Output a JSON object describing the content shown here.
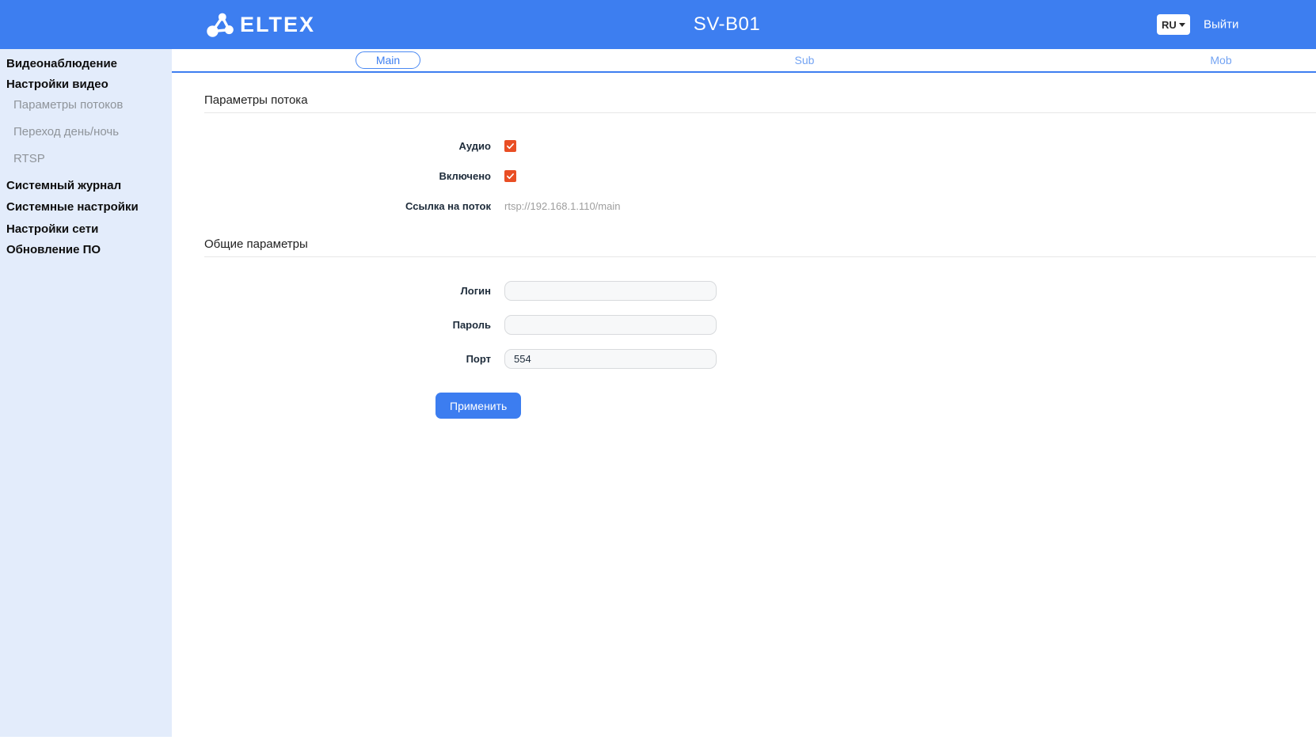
{
  "header": {
    "brand": "ELTEX",
    "title": "SV-B01",
    "language": "RU",
    "logout_label": "Выйти"
  },
  "sidebar": {
    "items": [
      {
        "label": "Видеонаблюдение",
        "type": "section"
      },
      {
        "label": "Настройки видео",
        "type": "section"
      },
      {
        "label": "Параметры потоков",
        "type": "sub"
      },
      {
        "label": "Переход день/ночь",
        "type": "sub"
      },
      {
        "label": "RTSP",
        "type": "sub"
      },
      {
        "label": "Системный журнал",
        "type": "section"
      },
      {
        "label": "Системные настройки",
        "type": "section"
      },
      {
        "label": "Настройки сети",
        "type": "section"
      },
      {
        "label": "Обновление ПО",
        "type": "section"
      }
    ]
  },
  "tabs": [
    {
      "label": "Main",
      "active": true
    },
    {
      "label": "Sub",
      "active": false
    },
    {
      "label": "Mob",
      "active": false
    }
  ],
  "stream_section": {
    "title": "Параметры потока",
    "audio": {
      "label": "Аудио",
      "checked": true
    },
    "enabled": {
      "label": "Включено",
      "checked": true
    },
    "stream_link": {
      "label": "Ссылка на поток",
      "value": "rtsp://192.168.1.110/main"
    }
  },
  "general_section": {
    "title": "Общие параметры",
    "login": {
      "label": "Логин",
      "value": ""
    },
    "password": {
      "label": "Пароль",
      "value": ""
    },
    "port": {
      "label": "Порт",
      "value": "554"
    },
    "apply_label": "Применить"
  },
  "colors": {
    "header_bar": "#3d7ef0",
    "sidebar_bg": "#e3ecfb",
    "tab_active": "#3f80f1",
    "tab_inactive": "#74a4f3",
    "checkbox": "#e94e24",
    "apply_button": "#3c7df0",
    "muted_value": "#9e9e9e"
  }
}
